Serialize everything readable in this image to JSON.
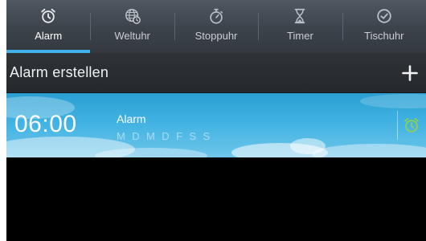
{
  "tabs": [
    {
      "label": "Alarm",
      "icon": "alarm-clock-icon",
      "active": true
    },
    {
      "label": "Weltuhr",
      "icon": "globe-clock-icon",
      "active": false
    },
    {
      "label": "Stoppuhr",
      "icon": "stopwatch-icon",
      "active": false
    },
    {
      "label": "Timer",
      "icon": "hourglass-icon",
      "active": false
    },
    {
      "label": "Tischuhr",
      "icon": "desk-clock-icon",
      "active": false
    }
  ],
  "header": {
    "title": "Alarm erstellen",
    "add_icon": "plus-icon"
  },
  "alarms": [
    {
      "time": "06:00",
      "name": "Alarm",
      "days": "M D M D F S S",
      "enabled": true,
      "toggle_icon": "alarm-clock-icon"
    }
  ],
  "colors": {
    "accent": "#43b2e6",
    "toggle_on": "#8fd14f"
  }
}
